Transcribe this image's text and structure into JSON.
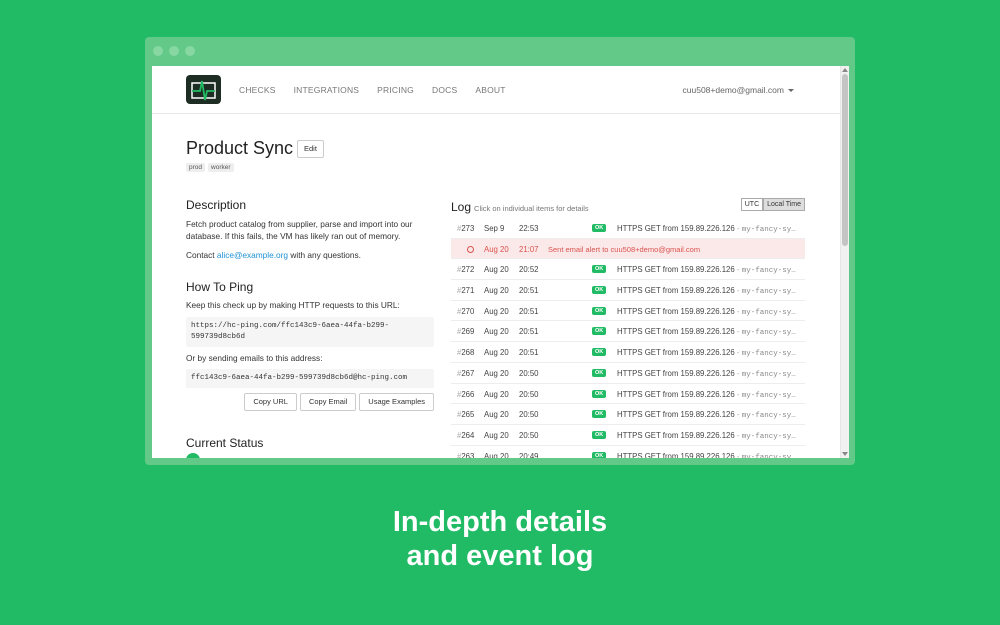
{
  "nav": {
    "links": [
      "CHECKS",
      "INTEGRATIONS",
      "PRICING",
      "DOCS",
      "ABOUT"
    ],
    "user": "cuu508+demo@gmail.com"
  },
  "check": {
    "name": "Product Sync",
    "edit_label": "Edit",
    "tags": [
      "prod",
      "worker"
    ]
  },
  "description": {
    "heading": "Description",
    "text": "Fetch product catalog from supplier, parse and import into our database. If this fails, the VM has likely ran out of memory.",
    "contact_prefix": "Contact ",
    "contact_email": "alice@example.org",
    "contact_suffix": " with any questions."
  },
  "ping": {
    "heading": "How To Ping",
    "http_text": "Keep this check up by making HTTP requests to this URL:",
    "url": "https://hc-ping.com/ffc143c9-6aea-44fa-b299-599739d8cb6d",
    "email_text": "Or by sending emails to this address:",
    "email": "ffc143c9-6aea-44fa-b299-599739d8cb6d@hc-ping.com",
    "buttons": [
      "Copy URL",
      "Copy Email",
      "Usage Examples"
    ]
  },
  "status": {
    "heading": "Current Status"
  },
  "log": {
    "title": "Log",
    "hint": "Click on individual items for details",
    "tz": [
      "UTC",
      "Local Time"
    ],
    "rows": [
      {
        "num": "273",
        "date": "Sep 9",
        "time": "22:53",
        "badge": "OK",
        "desc": "HTTPS GET from 159.89.226.126",
        "ua": "my-fancy-sy…"
      },
      {
        "alert": true,
        "date": "Aug 20",
        "time": "21:07",
        "text": "Sent email alert to cuu508+demo@gmail.com"
      },
      {
        "num": "272",
        "date": "Aug 20",
        "time": "20:52",
        "badge": "OK",
        "desc": "HTTPS GET from 159.89.226.126",
        "ua": "my-fancy-sy…"
      },
      {
        "num": "271",
        "date": "Aug 20",
        "time": "20:51",
        "badge": "OK",
        "desc": "HTTPS GET from 159.89.226.126",
        "ua": "my-fancy-sy…"
      },
      {
        "num": "270",
        "date": "Aug 20",
        "time": "20:51",
        "badge": "OK",
        "desc": "HTTPS GET from 159.89.226.126",
        "ua": "my-fancy-sy…"
      },
      {
        "num": "269",
        "date": "Aug 20",
        "time": "20:51",
        "badge": "OK",
        "desc": "HTTPS GET from 159.89.226.126",
        "ua": "my-fancy-sy…"
      },
      {
        "num": "268",
        "date": "Aug 20",
        "time": "20:51",
        "badge": "OK",
        "desc": "HTTPS GET from 159.89.226.126",
        "ua": "my-fancy-sy…"
      },
      {
        "num": "267",
        "date": "Aug 20",
        "time": "20:50",
        "badge": "OK",
        "desc": "HTTPS GET from 159.89.226.126",
        "ua": "my-fancy-sy…"
      },
      {
        "num": "266",
        "date": "Aug 20",
        "time": "20:50",
        "badge": "OK",
        "desc": "HTTPS GET from 159.89.226.126",
        "ua": "my-fancy-sy…"
      },
      {
        "num": "265",
        "date": "Aug 20",
        "time": "20:50",
        "badge": "OK",
        "desc": "HTTPS GET from 159.89.226.126",
        "ua": "my-fancy-sy…"
      },
      {
        "num": "264",
        "date": "Aug 20",
        "time": "20:50",
        "badge": "OK",
        "desc": "HTTPS GET from 159.89.226.126",
        "ua": "my-fancy-sy…"
      },
      {
        "num": "263",
        "date": "Aug 20",
        "time": "20:49",
        "badge": "OK",
        "desc": "HTTPS GET from 159.89.226.126",
        "ua": "my-fancy-sy…"
      }
    ]
  },
  "caption": {
    "line1": "In-depth details",
    "line2": "and event log"
  },
  "colors": {
    "background": "#22bb65",
    "ok_badge": "#22bb65",
    "alert": "#d9534f",
    "link": "#1e90d6"
  }
}
